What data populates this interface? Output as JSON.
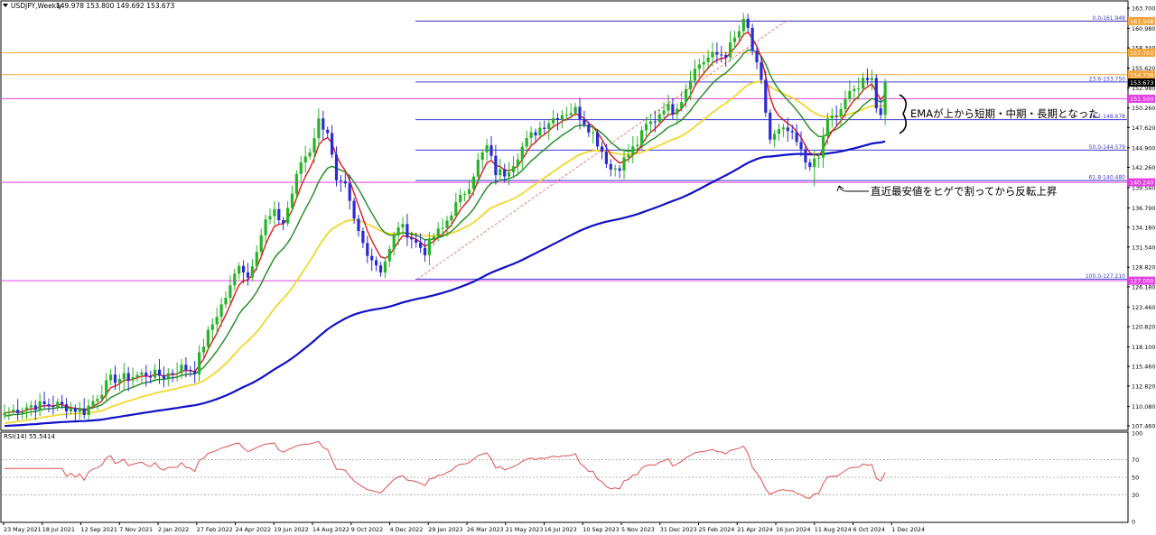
{
  "header": {
    "dropdown_icon": "triangle-down-icon",
    "title": "USDJPY,Weekly",
    "ohlc": "149.978 153.800 149.692 153.673"
  },
  "rsi": {
    "label": "RSI(14) 55.5414",
    "axis": [
      "100",
      "70",
      "50",
      "30",
      "0"
    ],
    "levels": [
      70,
      50,
      30
    ]
  },
  "annotations": {
    "ema_text": "EMAが上から短期・中期・長期となった",
    "wick_text": "直近最安値をヒゲで割ってから反転上昇"
  },
  "colors": {
    "bull": "#26b526",
    "bear": "#2b2bd6",
    "ema_short": "#e01818",
    "ema_mid": "#1e8a1e",
    "ema_long": "#f3d317",
    "ema_200": "#1010c8",
    "magenta": "#e040e0",
    "orange": "#f2a33a",
    "fib_line": "#3a3ad0",
    "rsi_line": "#e25050"
  },
  "chart_data": {
    "type": "candlestick",
    "title": "USDJPY,Weekly",
    "y_axis_ticks": [
      "163.700",
      "160.980",
      "158.340",
      "155.620",
      "152.980",
      "150.260",
      "147.620",
      "144.900",
      "142.260",
      "139.540",
      "136.790",
      "134.180",
      "131.540",
      "128.820",
      "126.180",
      "123.460",
      "120.820",
      "118.100",
      "115.460",
      "112.820",
      "110.080",
      "107.460"
    ],
    "x_axis_labels": [
      "23 May 2021",
      "18 Jul 2021",
      "12 Sep 2021",
      "7 Nov 2021",
      "2 Jan 2022",
      "27 Feb 2022",
      "24 Apr 2022",
      "19 Jun 2022",
      "14 Aug 2022",
      "9 Oct 2022",
      "4 Dec 2022",
      "29 Jan 2023",
      "26 Mar 2023",
      "21 May 2023",
      "16 Jul 2023",
      "10 Sep 2023",
      "5 Nov 2023",
      "31 Dec 2023",
      "25 Feb 2024",
      "21 Apr 2024",
      "16 Jun 2024",
      "11 Aug 2024",
      "6 Oct 2024",
      "1 Dec 2024"
    ],
    "ylim": [
      107.46,
      163.7
    ],
    "price_labels": [
      {
        "text": "161.948",
        "value": 161.948,
        "color": "orange"
      },
      {
        "text": "157.701",
        "value": 157.701,
        "color": "orange"
      },
      {
        "text": "154.738",
        "value": 154.738,
        "color": "orange"
      },
      {
        "text": "153.673",
        "value": 153.673,
        "color": "black"
      },
      {
        "text": "151.500",
        "value": 151.5,
        "color": "magenta"
      },
      {
        "text": "140.240",
        "value": 140.24,
        "color": "magenta"
      },
      {
        "text": "127.000",
        "value": 127.0,
        "color": "magenta"
      }
    ],
    "horizontal_lines": [
      {
        "value": 161.948,
        "color": "orange",
        "from": "right-part"
      },
      {
        "value": 157.701,
        "color": "orange",
        "from": "full"
      },
      {
        "value": 154.738,
        "color": "orange",
        "from": "full"
      },
      {
        "value": 151.5,
        "color": "magenta",
        "from": "full"
      },
      {
        "value": 140.24,
        "color": "magenta",
        "from": "full"
      },
      {
        "value": 127.0,
        "color": "magenta",
        "from": "full"
      }
    ],
    "fibonacci": [
      {
        "label": "0.0-161.948",
        "value": 161.948
      },
      {
        "label": "23.6-153.750",
        "value": 153.75
      },
      {
        "label": "38.2-148.678",
        "value": 148.678
      },
      {
        "label": "50.0-144.579",
        "value": 144.579
      },
      {
        "label": "61.8-140.480",
        "value": 140.48
      },
      {
        "label": "100.0-127.210",
        "value": 127.21
      }
    ],
    "series": [
      {
        "name": "",
        "color": "ema_short"
      },
      {
        "name": "",
        "color": "ema_mid"
      },
      {
        "name": "",
        "color": "ema_long"
      },
      {
        "name": "",
        "color": "ema_200"
      }
    ],
    "anchors": [
      [
        0,
        109.2
      ],
      [
        6,
        110.2
      ],
      [
        12,
        110.3
      ],
      [
        18,
        109.4
      ],
      [
        20,
        110.8
      ],
      [
        24,
        113.7
      ],
      [
        28,
        114.0
      ],
      [
        32,
        114.5
      ],
      [
        36,
        114.2
      ],
      [
        40,
        115.3
      ],
      [
        43,
        115.0
      ],
      [
        45,
        118.5
      ],
      [
        48,
        122.5
      ],
      [
        51,
        126.0
      ],
      [
        53,
        129.5
      ],
      [
        55,
        127.5
      ],
      [
        57,
        131.5
      ],
      [
        59,
        135.0
      ],
      [
        61,
        136.0
      ],
      [
        63,
        134.8
      ],
      [
        65,
        138.8
      ],
      [
        67,
        143.0
      ],
      [
        69,
        144.6
      ],
      [
        71,
        148.5
      ],
      [
        73,
        147.2
      ],
      [
        75,
        140.0
      ],
      [
        77,
        139.5
      ],
      [
        79,
        135.0
      ],
      [
        81,
        132.0
      ],
      [
        83,
        130.0
      ],
      [
        85,
        128.5
      ],
      [
        87,
        131.0
      ],
      [
        89,
        134.5
      ],
      [
        91,
        133.5
      ],
      [
        93,
        132.0
      ],
      [
        95,
        131.0
      ],
      [
        97,
        133.0
      ],
      [
        99,
        134.0
      ],
      [
        101,
        136.3
      ],
      [
        103,
        138.0
      ],
      [
        105,
        140.0
      ],
      [
        107,
        143.0
      ],
      [
        109,
        145.0
      ],
      [
        111,
        141.6
      ],
      [
        113,
        141.5
      ],
      [
        115,
        143.0
      ],
      [
        117,
        145.0
      ],
      [
        119,
        146.5
      ],
      [
        121,
        147.6
      ],
      [
        123,
        148.5
      ],
      [
        125,
        149.3
      ],
      [
        127,
        149.7
      ],
      [
        129,
        150.0
      ],
      [
        131,
        148.5
      ],
      [
        133,
        146.8
      ],
      [
        135,
        144.5
      ],
      [
        137,
        142.0
      ],
      [
        139,
        142.5
      ],
      [
        141,
        144.0
      ],
      [
        143,
        145.5
      ],
      [
        145,
        147.8
      ],
      [
        147,
        148.7
      ],
      [
        149,
        150.5
      ],
      [
        151,
        150.0
      ],
      [
        153,
        151.5
      ],
      [
        155,
        154.6
      ],
      [
        157,
        156.2
      ],
      [
        159,
        157.0
      ],
      [
        161,
        157.4
      ],
      [
        163,
        157.6
      ],
      [
        165,
        159.5
      ],
      [
        167,
        161.7
      ],
      [
        168,
        160.8
      ],
      [
        169,
        158.0
      ],
      [
        171,
        153.5
      ],
      [
        173,
        146.0
      ],
      [
        175,
        147.0
      ],
      [
        177,
        147.1
      ],
      [
        179,
        145.5
      ],
      [
        181,
        143.0
      ],
      [
        183,
        142.8
      ],
      [
        184,
        143.5
      ],
      [
        186,
        149.0
      ],
      [
        188,
        148.7
      ],
      [
        190,
        151.5
      ],
      [
        192,
        152.5
      ],
      [
        194,
        154.5
      ],
      [
        196,
        153.6
      ],
      [
        197,
        150.0
      ],
      [
        198,
        149.8
      ],
      [
        199,
        153.67
      ]
    ],
    "ema_short_final": 151.0,
    "ema_mid_final": 150.0,
    "ema_long_final": 148.0,
    "ema_200_final": 138.0
  }
}
